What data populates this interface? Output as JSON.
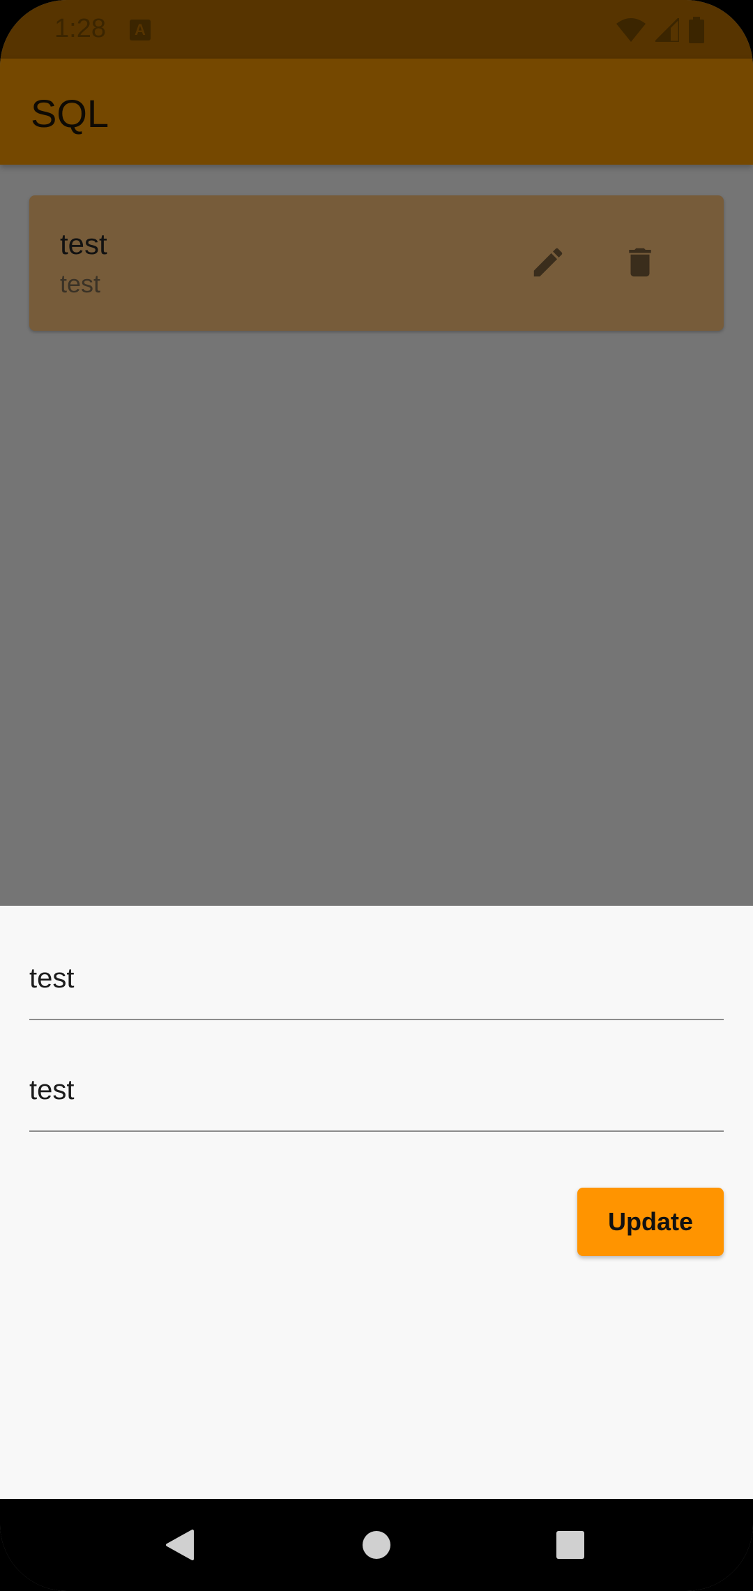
{
  "status_bar": {
    "time": "1:28",
    "notification_icon": "a-notification-icon",
    "icons": [
      "wifi-icon",
      "signal-icon",
      "battery-icon"
    ],
    "background": "#573400"
  },
  "app_bar": {
    "title": "SQL",
    "background": "#754800"
  },
  "list": {
    "items": [
      {
        "title": "test",
        "subtitle": "test",
        "actions": [
          "edit-icon",
          "delete-icon"
        ]
      }
    ]
  },
  "sheet": {
    "fields": [
      {
        "value": "test"
      },
      {
        "value": "test"
      }
    ],
    "update_label": "Update",
    "accent": "#ff9400"
  },
  "nav_bar": {
    "buttons": [
      "back-icon",
      "home-icon",
      "recents-icon"
    ]
  }
}
